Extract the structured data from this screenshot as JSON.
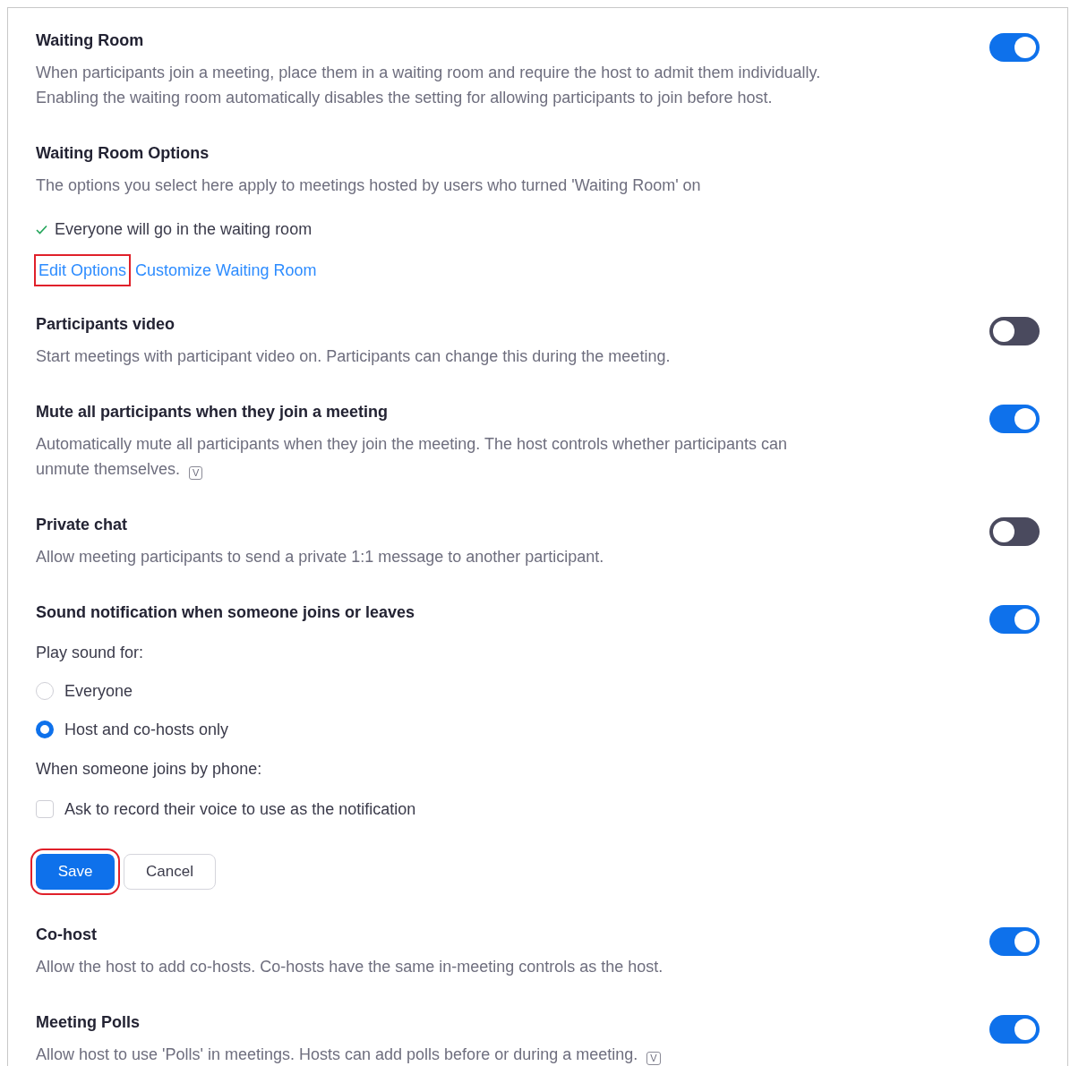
{
  "settings": [
    {
      "kind": "toggle",
      "title": "Waiting Room",
      "description": "When participants join a meeting, place them in a waiting room and require the host to admit them individually.\nEnabling the waiting room automatically disables the setting for allowing participants to join before host.",
      "on": true
    },
    {
      "kind": "options",
      "title": "Waiting Room Options",
      "description": "The options you select here apply to meetings hosted by users who turned 'Waiting Room' on",
      "checked_item": "Everyone will go in the waiting room",
      "links": [
        {
          "label": "Edit Options",
          "highlighted": true
        },
        {
          "label": "Customize Waiting Room",
          "highlighted": false
        }
      ]
    },
    {
      "kind": "toggle",
      "title": "Participants video",
      "description": "Start meetings with participant video on. Participants can change this during the meeting.",
      "on": false
    },
    {
      "kind": "toggle",
      "title": "Mute all participants when they join a meeting",
      "description": "Automatically mute all participants when they join the meeting. The host controls whether participants can\nunmute themselves.",
      "badge": "V",
      "on": true
    },
    {
      "kind": "toggle",
      "title": "Private chat",
      "description": "Allow meeting participants to send a private 1:1 message to another participant.",
      "on": false
    },
    {
      "kind": "toggle",
      "title": "Sound notification when someone joins or leaves",
      "on": true,
      "play_sound_label": "Play sound for:",
      "radios": [
        {
          "label": "Everyone",
          "selected": false
        },
        {
          "label": "Host and co-hosts only",
          "selected": true
        }
      ],
      "phone_label": "When someone joins by phone:",
      "checkboxes": [
        {
          "label": "Ask to record their voice to use as the notification",
          "checked": false
        }
      ],
      "buttons": [
        {
          "label": "Save",
          "kind": "primary",
          "highlighted": true
        },
        {
          "label": "Cancel",
          "kind": "secondary",
          "highlighted": false
        }
      ]
    },
    {
      "kind": "toggle",
      "title": "Co-host",
      "description": "Allow the host to add co-hosts. Co-hosts have the same in-meeting controls as the host.",
      "on": true
    },
    {
      "kind": "toggle",
      "title": "Meeting Polls",
      "description": "Allow host to use 'Polls' in meetings. Hosts can add polls before or during a meeting.",
      "badge": "V",
      "on": true
    }
  ]
}
